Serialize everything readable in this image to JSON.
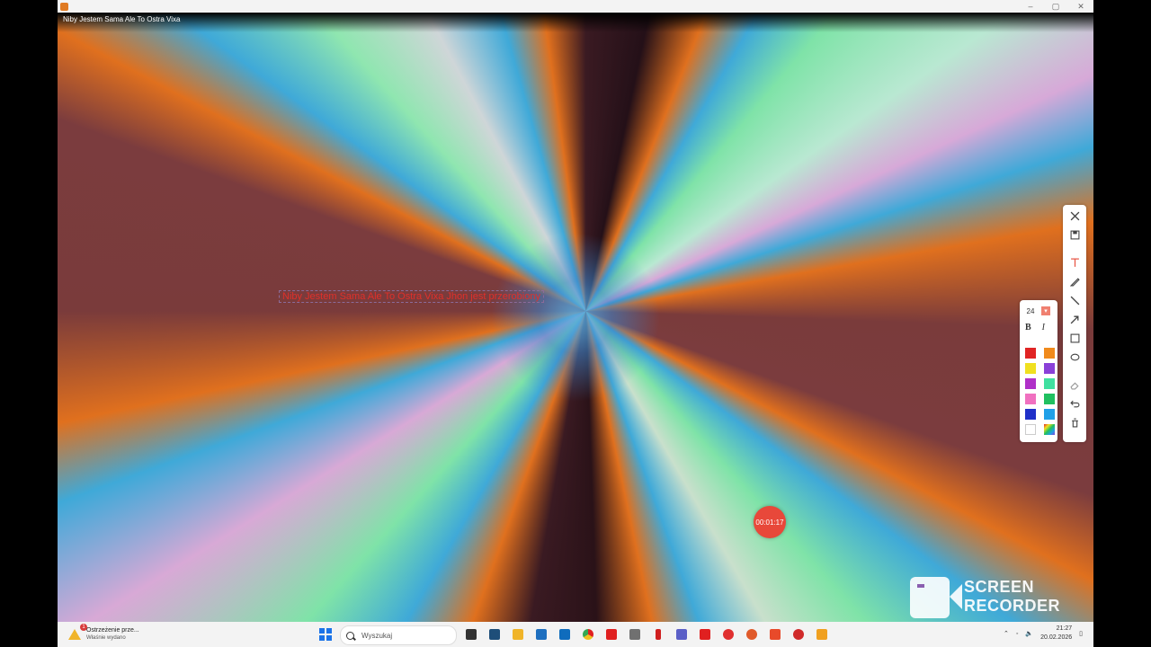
{
  "window": {
    "controls": [
      "–",
      "▢",
      "✕"
    ]
  },
  "video": {
    "title": "Niby Jestem Sama Ale To Ostra Vixa",
    "typed_text": "Niby Jestem Sama Ale To Ostra Vixa Jhon jest przerobiony"
  },
  "toolbar": {
    "icons": [
      "close-icon",
      "save-icon",
      "text-icon",
      "pencil-icon",
      "line-icon",
      "arrow-icon",
      "rectangle-icon",
      "ellipse-icon",
      "eraser-icon",
      "undo-icon",
      "trash-icon"
    ]
  },
  "palette": {
    "font_size": "24",
    "bold_label": "B",
    "italic_label": "I",
    "colors": [
      "#e02424",
      "#f08a1c",
      "#f0e020",
      "#8a40d8",
      "#b030c8",
      "#40e0a0",
      "#f070c0",
      "#20c060",
      "#2030c8",
      "#20a0e8",
      "#ffffff",
      "rainbow"
    ]
  },
  "recorder": {
    "timer": "00:01:17",
    "watermark_line1": "SCREEN",
    "watermark_line2": "RECORDER"
  },
  "taskbar": {
    "notification_title": "Ostrzeżenie prze...",
    "notification_sub": "Właśnie wydano",
    "notification_badge": "1",
    "search_placeholder": "Wyszukaj",
    "app_colors": [
      "#333333",
      "#1e4e79",
      "#f0b429",
      "#1e6fbf",
      "#0f6cbd",
      "#34a853",
      "#e02020",
      "#707070",
      "#d01f1f",
      "#5b5fc7",
      "#e02020",
      "#e03030",
      "#e05a2a",
      "#e84a2a",
      "#d02a2a",
      "#f0a020"
    ],
    "time": "21:27",
    "date": "20.02.2026"
  }
}
